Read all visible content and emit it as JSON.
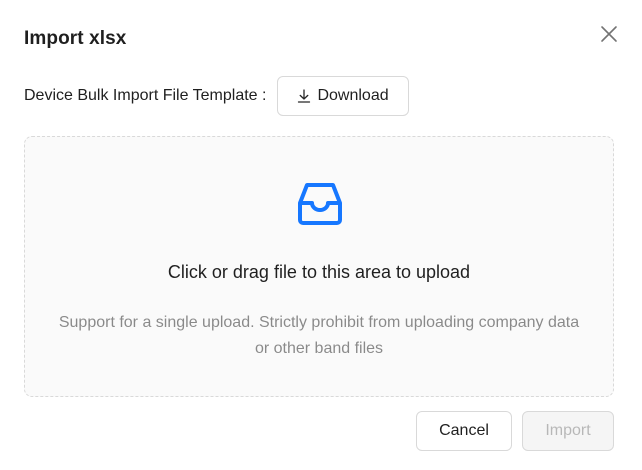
{
  "dialog": {
    "title": "Import xlsx",
    "close_icon": "close-icon"
  },
  "template": {
    "label": "Device Bulk Import File Template :",
    "download_label": "Download",
    "download_icon": "download-icon"
  },
  "dropzone": {
    "icon": "inbox-icon",
    "icon_color": "#1677ff",
    "text": "Click or drag file to this area to upload",
    "hint_line1": "Support for a single upload. Strictly prohibit from uploading company data",
    "hint_line2": "or other band files"
  },
  "footer": {
    "cancel_label": "Cancel",
    "import_label": "Import",
    "import_disabled": true
  }
}
